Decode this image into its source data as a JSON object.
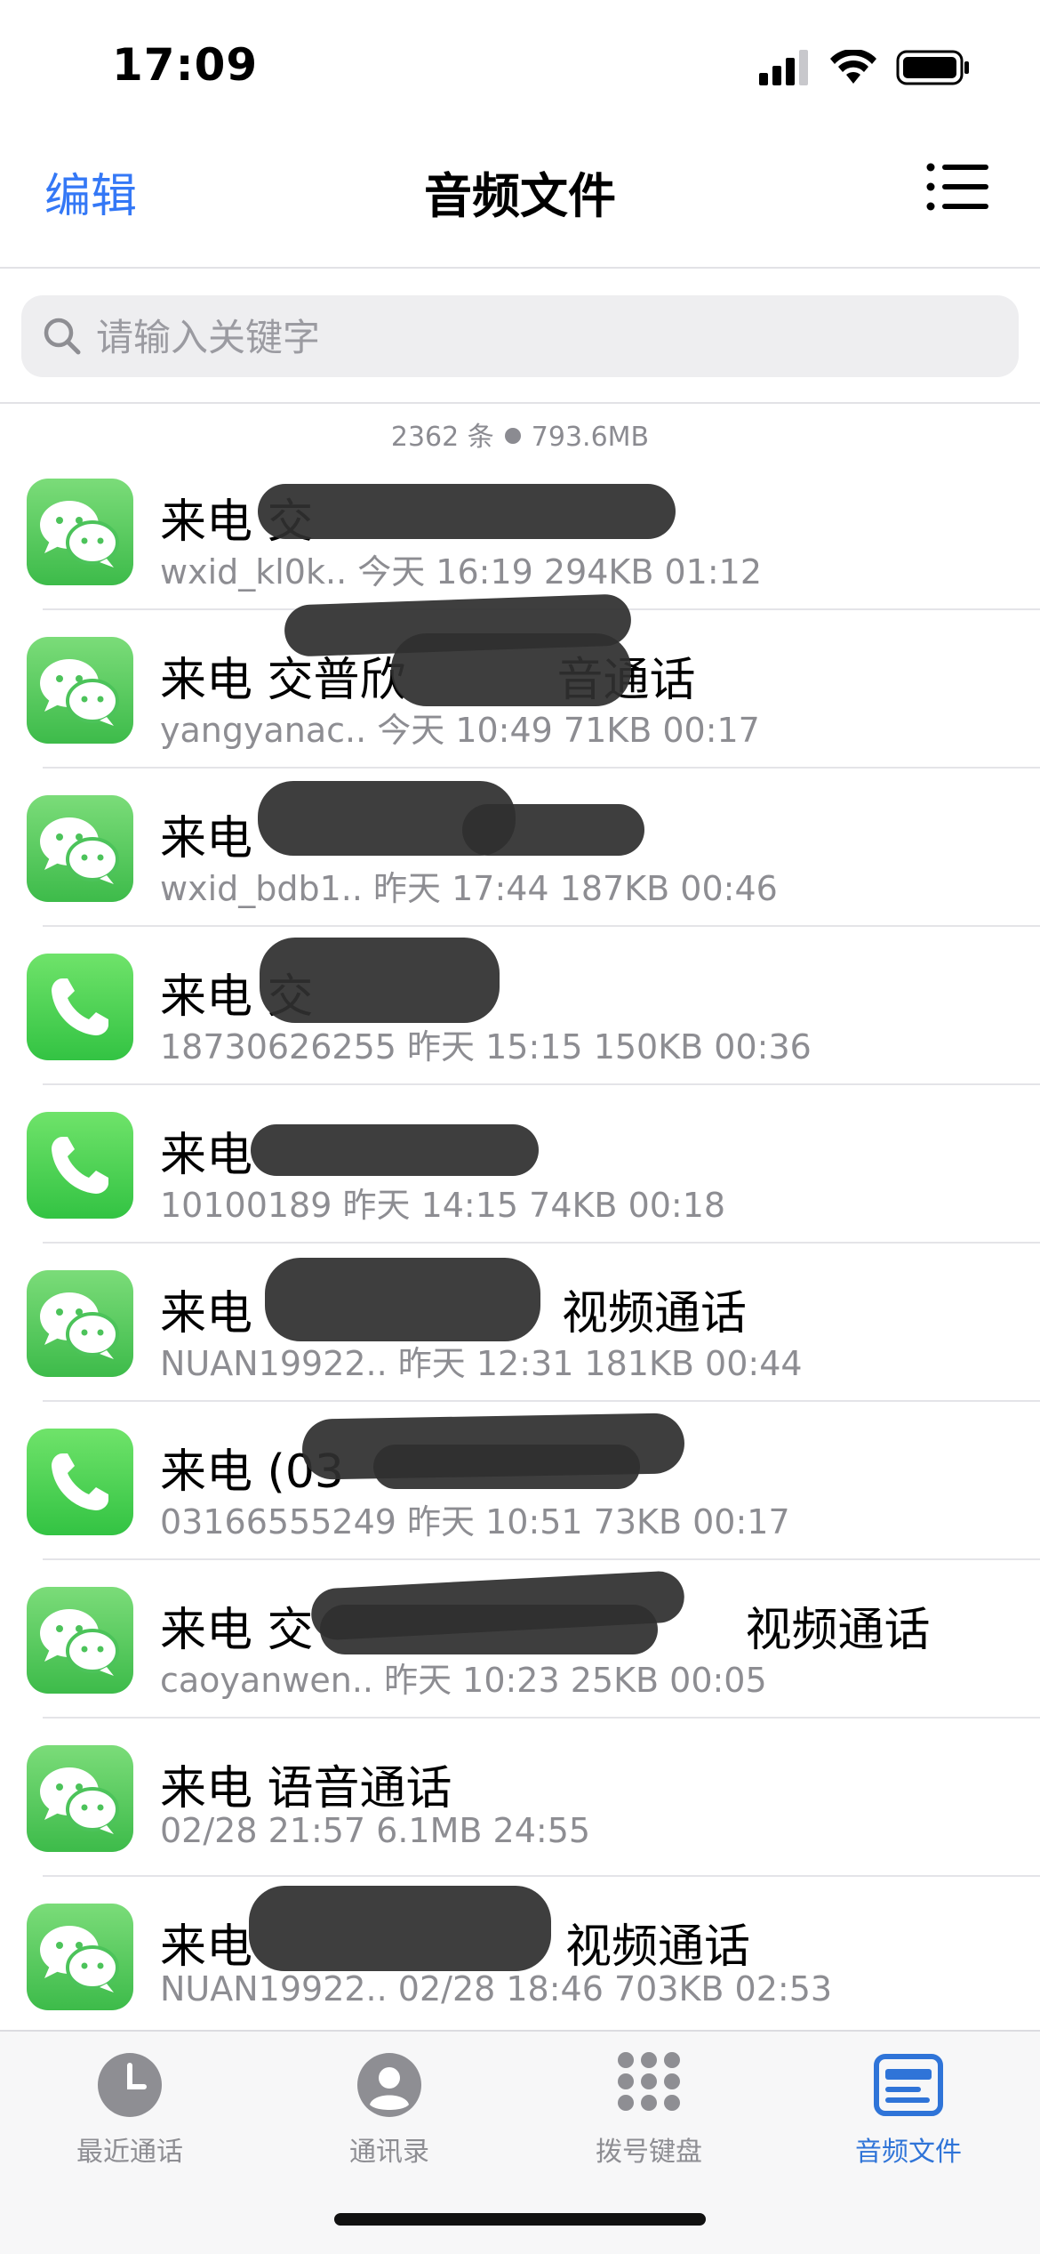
{
  "status_bar": {
    "time": "17:09"
  },
  "nav": {
    "edit_label": "编辑",
    "title": "音频文件"
  },
  "search": {
    "placeholder": "请输入关键字"
  },
  "summary": {
    "count": "2362 条",
    "size": "793.6MB"
  },
  "items": [
    {
      "app": "wechat",
      "title": "来电 交",
      "subtitle": "wxid_kl0k.. 今天 16:19 294KB 01:12"
    },
    {
      "app": "wechat",
      "title": "来电 交普欣",
      "title_tail": "音通话",
      "subtitle": "yangyanac.. 今天 10:49 71KB 00:17"
    },
    {
      "app": "wechat",
      "title": "来电",
      "subtitle": "wxid_bdb1.. 昨天 17:44 187KB 00:46"
    },
    {
      "app": "phone",
      "title": "来电 交",
      "subtitle": "18730626255 昨天 15:15 150KB 00:36"
    },
    {
      "app": "phone",
      "title": "来电",
      "subtitle": "10100189 昨天 14:15 74KB 00:18"
    },
    {
      "app": "wechat",
      "title": "来电",
      "title_tail": "视频通话",
      "subtitle": "NUAN19922.. 昨天 12:31 181KB 00:44"
    },
    {
      "app": "phone",
      "title": "来电 (03",
      "subtitle": "03166555249 昨天 10:51 73KB 00:17"
    },
    {
      "app": "wechat",
      "title": "来电 交",
      "title_tail": "视频通话",
      "subtitle": "caoyanwen.. 昨天 10:23 25KB 00:05"
    },
    {
      "app": "wechat",
      "title": "来电  语音通话",
      "subtitle": " 02/28 21:57 6.1MB 24:55"
    },
    {
      "app": "wechat",
      "title": "来电",
      "title_tail": "视频通话",
      "subtitle": "NUAN19922.. 02/28 18:46 703KB 02:53"
    }
  ],
  "tabs": [
    {
      "label": "最近通话",
      "icon": "clock-icon",
      "active": false
    },
    {
      "label": "通讯录",
      "icon": "contacts-icon",
      "active": false
    },
    {
      "label": "拨号键盘",
      "icon": "keypad-icon",
      "active": false
    },
    {
      "label": "音频文件",
      "icon": "audio-files-icon",
      "active": true
    }
  ],
  "colors": {
    "accent": "#3478f6",
    "active_tab": "#2f74d8",
    "wechat_green": "#4cc35a"
  }
}
